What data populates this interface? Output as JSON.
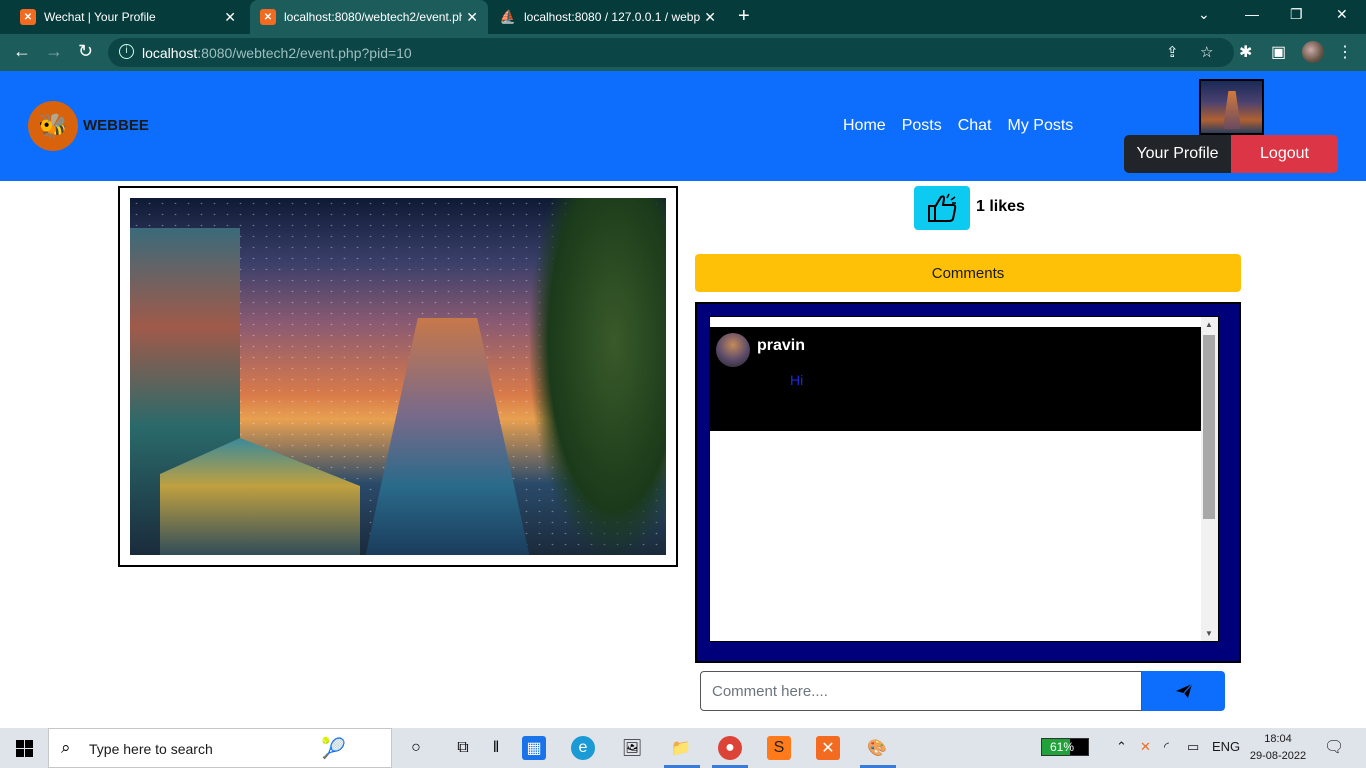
{
  "browser": {
    "tabs": [
      {
        "title": "Wechat | Your Profile",
        "active": false
      },
      {
        "title": "localhost:8080/webtech2/event.php",
        "active": true
      },
      {
        "title": "localhost:8080 / 127.0.0.1 / webp",
        "active": false
      }
    ],
    "url_host": "localhost",
    "url_rest": ":8080/webtech2/event.php?pid=10"
  },
  "header": {
    "brand": "WEBBEE",
    "nav": [
      "Home",
      "Posts",
      "Chat",
      "My Posts"
    ],
    "profile_button": "Your Profile",
    "logout_button": "Logout"
  },
  "post": {
    "likes_text": "1 likes",
    "comments_label": "Comments",
    "comments": [
      {
        "user": "pravin",
        "text": "Hi"
      }
    ],
    "comment_placeholder": "Comment here...."
  },
  "taskbar": {
    "search_placeholder": "Type here to search",
    "battery": "61%",
    "language": "ENG",
    "time": "18:04",
    "date": "29-08-2022"
  },
  "colors": {
    "header": "#0d6efd",
    "like": "#0dcaf0",
    "comments_bar": "#ffc107",
    "comments_box": "#00007a",
    "logout": "#dc3545"
  }
}
